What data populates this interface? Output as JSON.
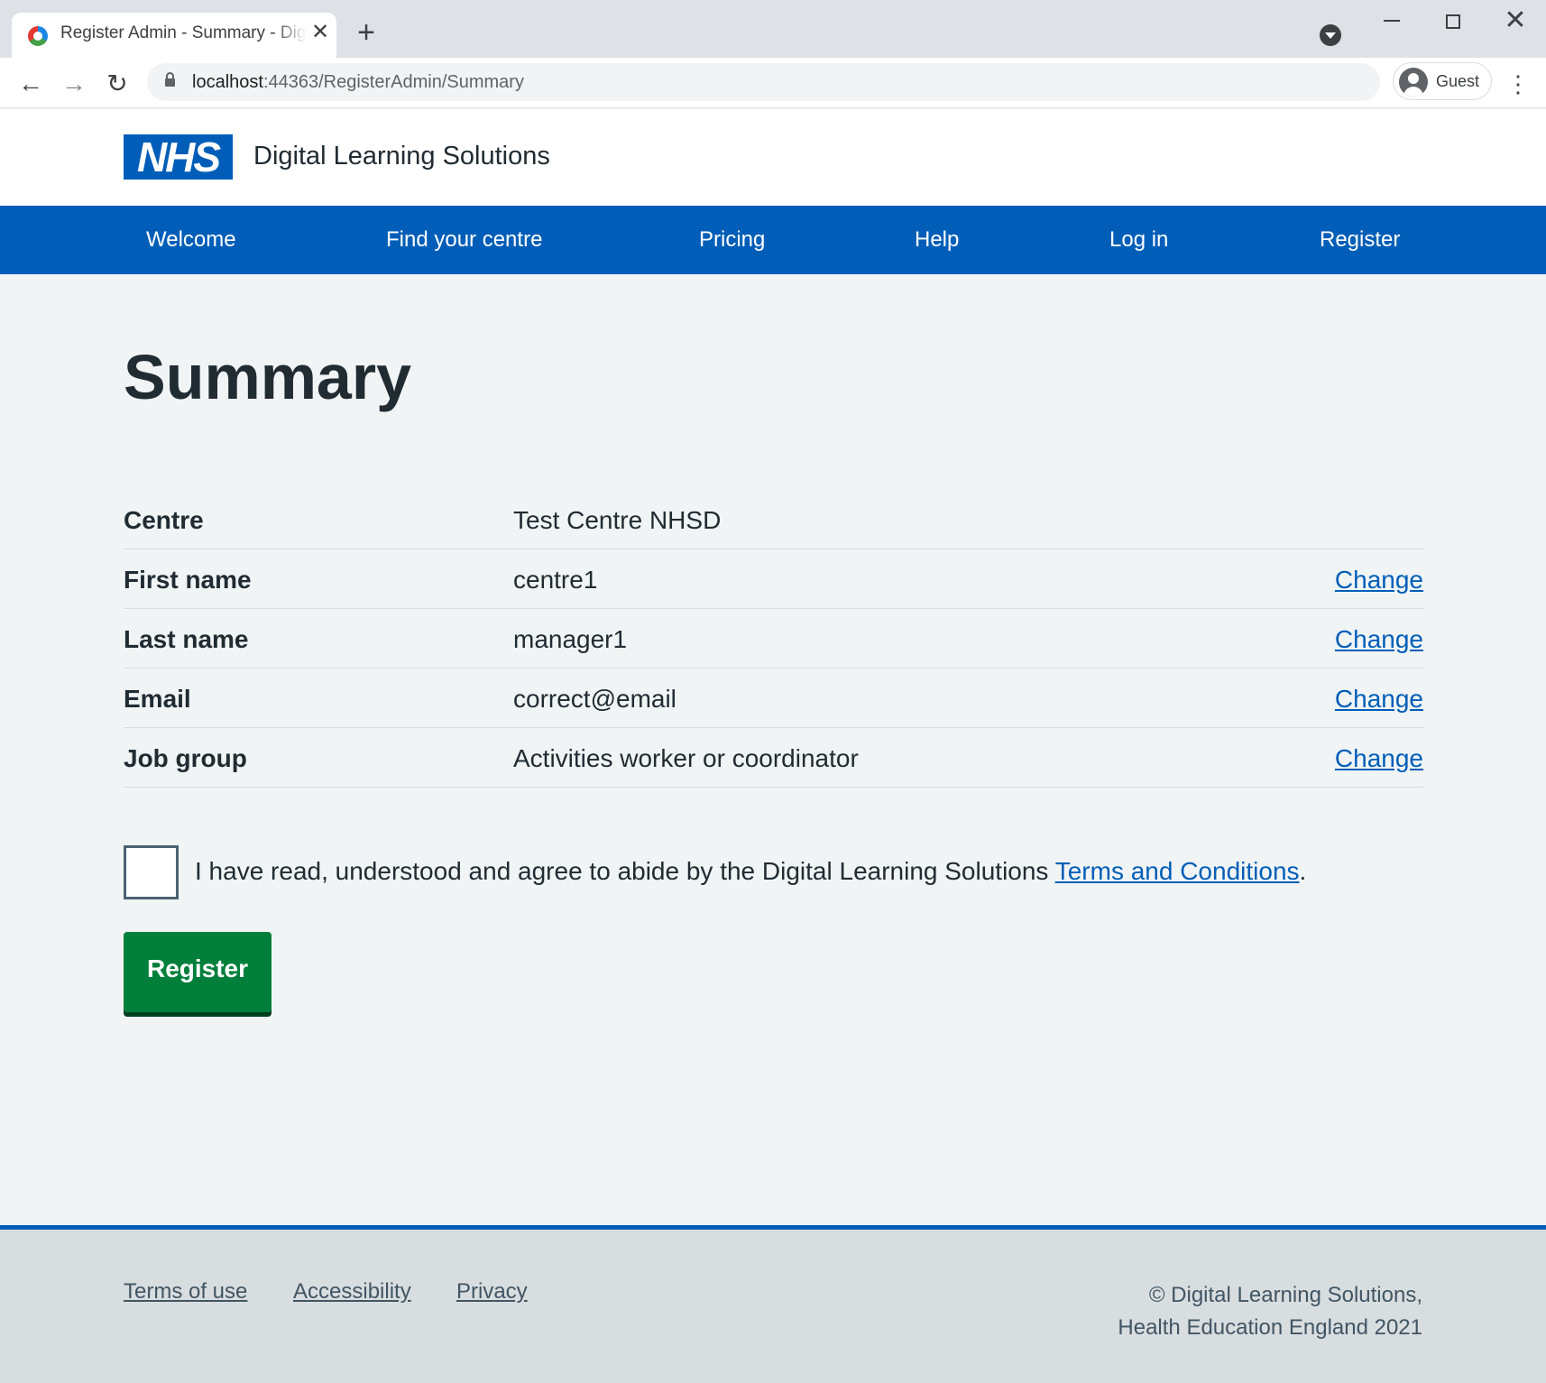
{
  "browser": {
    "tab_title": "Register Admin - Summary - Digital Learning Solutions",
    "tab_close": "✕",
    "new_tab": "+",
    "url_host": "localhost",
    "url_path": ":44363/RegisterAdmin/Summary",
    "profile_label": "Guest",
    "nav_back": "←",
    "nav_forward": "→",
    "nav_reload": "↻",
    "menu": "⋮",
    "window_close": "✕"
  },
  "header": {
    "logo_text": "NHS",
    "service_name": "Digital Learning Solutions"
  },
  "nav": {
    "items": [
      {
        "label": "Welcome"
      },
      {
        "label": "Find your centre"
      },
      {
        "label": "Pricing"
      },
      {
        "label": "Help"
      },
      {
        "label": "Log in"
      },
      {
        "label": "Register"
      }
    ]
  },
  "page": {
    "title": "Summary"
  },
  "summary": {
    "rows": [
      {
        "key": "Centre",
        "value": "Test Centre NHSD",
        "action": ""
      },
      {
        "key": "First name",
        "value": "centre1",
        "action": "Change"
      },
      {
        "key": "Last name",
        "value": "manager1",
        "action": "Change"
      },
      {
        "key": "Email",
        "value": "correct@email",
        "action": "Change"
      },
      {
        "key": "Job group",
        "value": "Activities worker or coordinator",
        "action": "Change"
      }
    ]
  },
  "terms": {
    "text": "I have read, understood and agree to abide by the Digital Learning Solutions ",
    "link": "Terms and Conditions",
    "suffix": ".",
    "checked": false
  },
  "register_button": "Register",
  "footer": {
    "links": [
      "Terms of use",
      "Accessibility",
      "Privacy"
    ],
    "copyright_line1": "© Digital Learning Solutions,",
    "copyright_line2": "Health Education England 2021"
  },
  "colors": {
    "nhs_blue": "#005eb8",
    "button_green": "#007f3b",
    "page_background": "#f0f4f5",
    "footer_background": "#d8dde0"
  }
}
